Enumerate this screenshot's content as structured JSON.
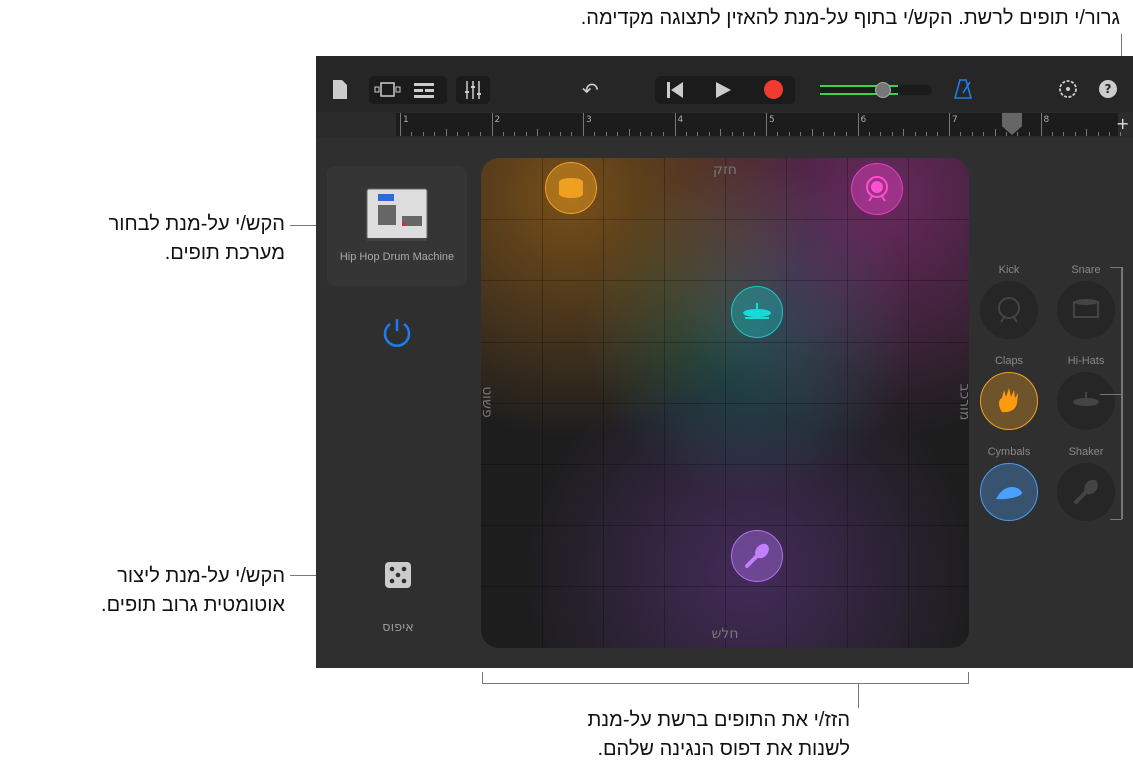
{
  "callouts": {
    "top": "גרור/י תופים לרשת. הקש/י בתוף על-מנת להאזין לתצוגה מקדימה.",
    "kit": [
      "הקש/י על-מנת לבחור",
      "מערכת תופים."
    ],
    "dice": [
      "הקש/י על-מנת ליצור",
      "אוטומטית גרוב תופים."
    ],
    "pad": [
      "הזז/י את התופים ברשת על-מנת",
      "לשנות את דפוס הנגינה שלהם."
    ]
  },
  "toolbar": {
    "volume_percent": 70,
    "accent": "#1e7cf2",
    "record_color": "#f23b30"
  },
  "ruler": {
    "bars": [
      "1",
      "2",
      "3",
      "4",
      "5",
      "6",
      "7",
      "8"
    ],
    "add": "+"
  },
  "kit": {
    "name": "Hip Hop Drum Machine"
  },
  "pad": {
    "top": "חזק",
    "bottom": "חלש",
    "left": "פשוט",
    "right": "מורכב",
    "nodes": [
      {
        "name": "snare",
        "color": "#f0a020"
      },
      {
        "name": "kick",
        "color": "#e040c0"
      },
      {
        "name": "hi-hats",
        "color": "#18c8c8"
      },
      {
        "name": "shaker",
        "color": "#b070f0"
      }
    ]
  },
  "instruments": [
    {
      "label": "Kick",
      "active": false
    },
    {
      "label": "Snare",
      "active": false
    },
    {
      "label": "Claps",
      "active": true,
      "color": "#f0a020"
    },
    {
      "label": "Hi-Hats",
      "active": false
    },
    {
      "label": "Cymbals",
      "active": true,
      "color": "#4a9cf0"
    },
    {
      "label": "Shaker",
      "active": false
    }
  ],
  "reset": "איפוס"
}
